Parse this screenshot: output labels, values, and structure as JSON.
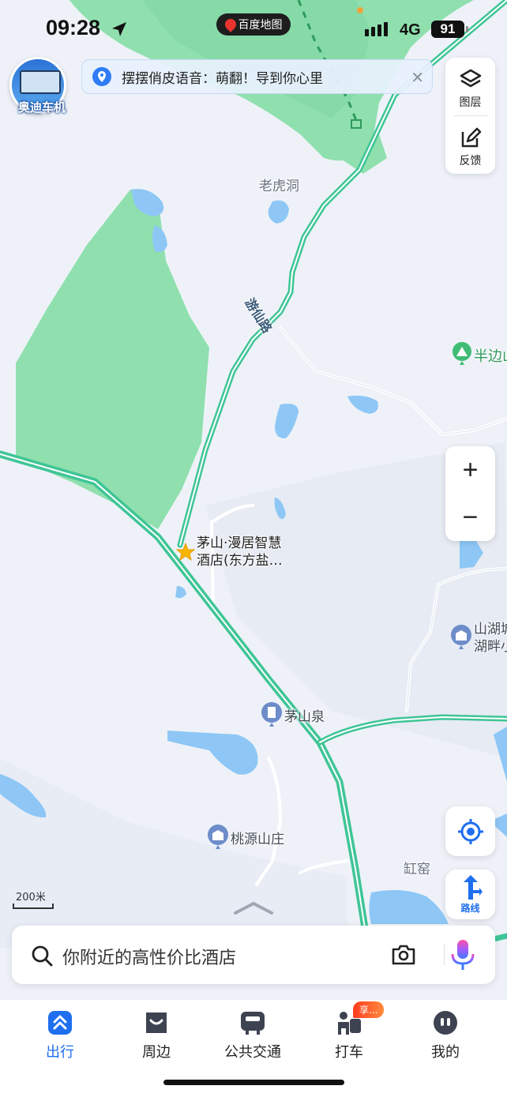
{
  "status_bar": {
    "time": "09:28",
    "network": "4G",
    "battery": "91"
  },
  "app_name": "百度地图",
  "promo": {
    "label": "奥迪车机"
  },
  "banner": {
    "text": "摆摆俏皮语音：萌翻！导到你心里"
  },
  "toolbox": {
    "layers_label": "图层",
    "feedback_label": "反馈"
  },
  "map": {
    "road_name": "游仙路",
    "places": {
      "laohudong": "老虎洞",
      "banbian": "半边山",
      "hotel_line1": "茅山·漫居智慧",
      "hotel_line2": "酒店(东方盐…",
      "shanhu_line1": "山湖城",
      "shanhu_line2": "湖畔小",
      "maoshanquan": "茅山泉",
      "taoyuan": "桃源山庄",
      "gangyao": "缸窑"
    },
    "scale": "200米"
  },
  "zoom": {
    "in": "+",
    "out": "−"
  },
  "route_label": "路线",
  "search": {
    "placeholder": "你附近的高性价比酒店"
  },
  "tabs": [
    {
      "label": "出行",
      "active": true
    },
    {
      "label": "周边"
    },
    {
      "label": "公共交通"
    },
    {
      "label": "打车",
      "badge": "享..."
    },
    {
      "label": "我的"
    }
  ],
  "colors": {
    "accent": "#1f6ff0",
    "road": "#3fc596",
    "water": "#8ec7f5",
    "forest": "#8fe0ae",
    "land": "#eef2f8"
  }
}
